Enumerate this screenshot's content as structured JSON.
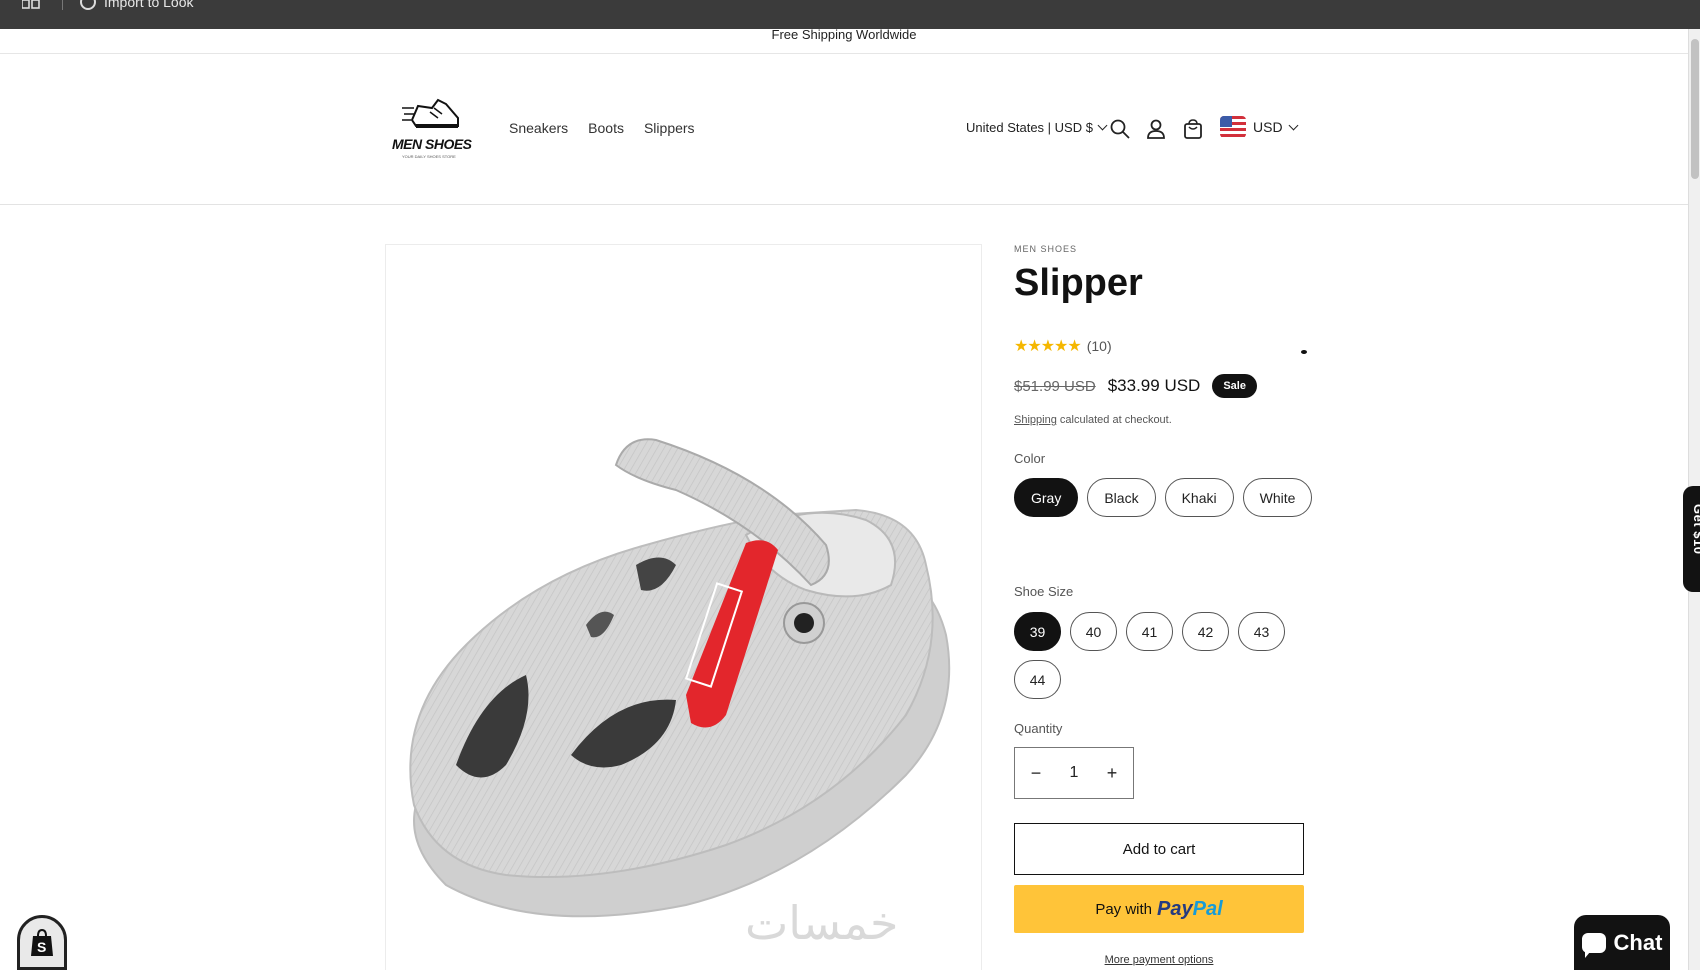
{
  "topbar": {
    "import_label": "Import to Look"
  },
  "announcement": "Free Shipping Worldwide",
  "header": {
    "logo_text": "MEN SHOES",
    "logo_tagline": "YOUR DAILY SHOES STORE",
    "nav": [
      "Sneakers",
      "Boots",
      "Slippers"
    ],
    "locale": "United States | USD $",
    "currency": "USD"
  },
  "product": {
    "vendor": "MEN SHOES",
    "title": "Slipper",
    "stars": "★★★★★",
    "rating_count": "(10)",
    "rating_value": 5,
    "compare_price": "$51.99 USD",
    "price": "$33.99 USD",
    "sale_badge": "Sale",
    "shipping_link": "Shipping",
    "shipping_text": " calculated at checkout.",
    "color_label": "Color",
    "colors": [
      "Gray",
      "Black",
      "Khaki",
      "White"
    ],
    "selected_color": "Gray",
    "size_label": "Shoe Size",
    "sizes": [
      "39",
      "40",
      "41",
      "42",
      "43",
      "44"
    ],
    "selected_size": "39",
    "quantity_label": "Quantity",
    "quantity": "1",
    "minus": "−",
    "plus": "+",
    "add_to_cart": "Add to cart",
    "paypal_prefix": "Pay with",
    "paypal_brand_1": "Pay",
    "paypal_brand_2": "Pal",
    "more_payment": "More payment options"
  },
  "watermark": "خمسات",
  "get_discount": "Get $10",
  "chat_label": "Chat",
  "colors": {
    "accent": "#121212",
    "paypal": "#ffc439",
    "paypal_blue": "#253b80",
    "paypal_light": "#179bd7",
    "star": "#f5b700",
    "shoe": "#d6d6d6",
    "strap_tag": "#e3262c"
  }
}
